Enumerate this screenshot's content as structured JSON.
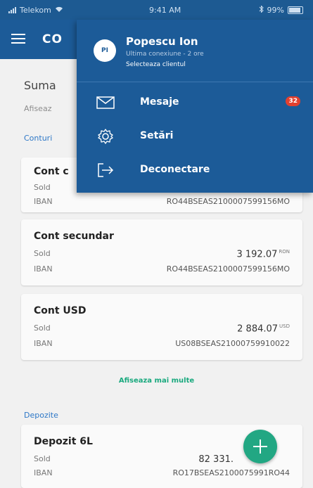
{
  "status_bar": {
    "carrier": "Telekom",
    "time": "9:41 AM",
    "battery": "99%"
  },
  "app_bar": {
    "title_visible": "CO"
  },
  "summary": {
    "sum_label": "Suma",
    "show_label": "Afiseaz",
    "accounts_label": "Conturi"
  },
  "accounts": [
    {
      "name": "Cont c",
      "sold_label": "Sold",
      "iban_label": "IBAN",
      "iban": "RO44BSEAS2100007599156MO"
    },
    {
      "name": "Cont secundar",
      "sold_label": "Sold",
      "amount": "3 192.07",
      "currency": "RON",
      "iban_label": "IBAN",
      "iban": "RO44BSEAS2100007599156MO"
    },
    {
      "name": "Cont USD",
      "sold_label": "Sold",
      "amount": "2 884.07",
      "currency": "USD",
      "iban_label": "IBAN",
      "iban": "US08BSEAS21000759910022"
    }
  ],
  "show_more": "Afiseaza mai multe",
  "deposits": {
    "label": "Depozite",
    "items": [
      {
        "name": "Depozit 6L",
        "sold_label": "Sold",
        "amount": "82 331.",
        "iban_label": "IBAN",
        "iban": "RO17BSEAS2100075991RO44"
      }
    ]
  },
  "drawer": {
    "avatar_initials": "PI",
    "user_name": "Popescu Ion",
    "last_login": "Ultima conexiune - 2 ore",
    "select_client": "Selecteaza clientul",
    "menu": [
      {
        "label": "Mesaje",
        "icon": "envelope-icon",
        "badge": "32"
      },
      {
        "label": "Setări",
        "icon": "gear-icon"
      },
      {
        "label": "Deconectare",
        "icon": "logout-icon"
      }
    ]
  },
  "colors": {
    "primary": "#1c5b98",
    "accent_green": "#22a783",
    "badge_red": "#e2402f",
    "link_blue": "#2e78c7"
  }
}
